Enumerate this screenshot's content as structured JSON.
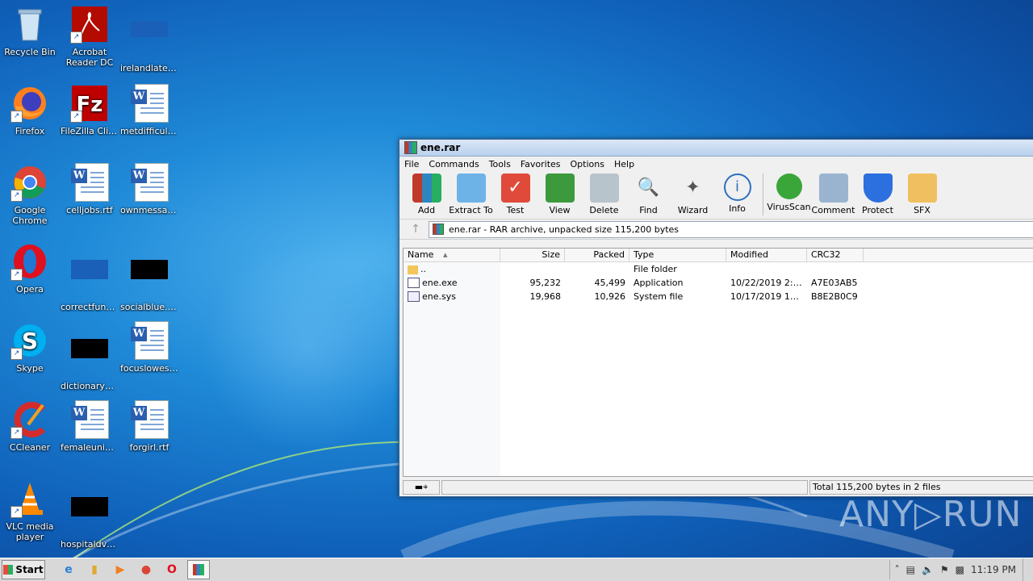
{
  "desktop": {
    "icons": [
      {
        "label": "Recycle Bin"
      },
      {
        "label": "Acrobat Reader DC"
      },
      {
        "label": "irelandlates..."
      },
      {
        "label": "Firefox"
      },
      {
        "label": "FileZilla Client"
      },
      {
        "label": "metdifficult.rtf"
      },
      {
        "label": "Google Chrome"
      },
      {
        "label": "celljobs.rtf"
      },
      {
        "label": "ownmessag..."
      },
      {
        "label": "Opera"
      },
      {
        "label": "correctfund..."
      },
      {
        "label": "socialblue.jpg"
      },
      {
        "label": "Skype"
      },
      {
        "label": "dictionarye..."
      },
      {
        "label": "focuslowest..."
      },
      {
        "label": "CCleaner"
      },
      {
        "label": "femaleuniq..."
      },
      {
        "label": "forgirl.rtf"
      },
      {
        "label": "VLC media player"
      },
      {
        "label": "hospitaldvd..."
      }
    ]
  },
  "window": {
    "title": "ene.rar",
    "menu": [
      "File",
      "Commands",
      "Tools",
      "Favorites",
      "Options",
      "Help"
    ],
    "toolbar": [
      "Add",
      "Extract To",
      "Test",
      "View",
      "Delete",
      "Find",
      "Wizard",
      "Info",
      "VirusScan",
      "Comment",
      "Protect",
      "SFX"
    ],
    "address": "ene.rar - RAR archive, unpacked size 115,200 bytes",
    "columns": {
      "name": "Name",
      "size": "Size",
      "packed": "Packed",
      "type": "Type",
      "modified": "Modified",
      "crc": "CRC32"
    },
    "files": [
      {
        "name": "..",
        "size": "",
        "packed": "",
        "type": "File folder",
        "modified": "",
        "crc": ""
      },
      {
        "name": "ene.exe",
        "size": "95,232",
        "packed": "45,499",
        "type": "Application",
        "modified": "10/22/2019 2:1...",
        "crc": "A7E03AB5"
      },
      {
        "name": "ene.sys",
        "size": "19,968",
        "packed": "10,926",
        "type": "System file",
        "modified": "10/17/2019 11:...",
        "crc": "B8E2B0C9"
      }
    ],
    "status": "Total 115,200 bytes in 2 files"
  },
  "taskbar": {
    "start": "Start",
    "clock": "11:19 PM"
  },
  "watermark": "ANY▷RUN"
}
